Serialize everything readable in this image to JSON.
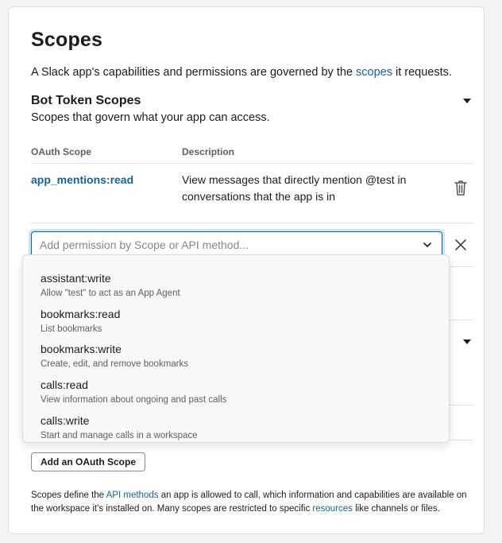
{
  "title": "Scopes",
  "intro": {
    "before": "A Slack app's capabilities and permissions are governed by the",
    "link": "scopes",
    "after": "it requests."
  },
  "bot_section": {
    "title": "Bot Token Scopes",
    "description": "Scopes that govern what your app can access."
  },
  "table": {
    "col_scope": "OAuth Scope",
    "col_description": "Description",
    "rows": [
      {
        "scope": "app_mentions:read",
        "description": "View messages that directly mention @test in conversations that the app is in"
      }
    ]
  },
  "scope_input": {
    "placeholder": "Add permission by Scope or API method..."
  },
  "dropdown_options": [
    {
      "name": "assistant:write",
      "description": "Allow \"test\" to act as an App Agent"
    },
    {
      "name": "bookmarks:read",
      "description": "List bookmarks"
    },
    {
      "name": "bookmarks:write",
      "description": "Create, edit, and remove bookmarks"
    },
    {
      "name": "calls:read",
      "description": "View information about ongoing and past calls"
    },
    {
      "name": "calls:write",
      "description": "Start and manage calls in a workspace"
    }
  ],
  "add_button": "Add an OAuth Scope",
  "footnote": {
    "p1": "Scopes define the",
    "link1": "API methods",
    "p2": "an app is allowed to call, which information and capabilities are available on the workspace it's installed on. Many scopes are restricted to specific",
    "link2": "resources",
    "p3": "like channels or files."
  },
  "icons": {
    "collapse": "caret-down-icon",
    "delete": "trash-icon",
    "dropdown": "chevron-down-icon",
    "clear": "close-icon"
  },
  "colors": {
    "link": "#1264a3",
    "text": "#1d1c1d",
    "muted": "#616061"
  }
}
